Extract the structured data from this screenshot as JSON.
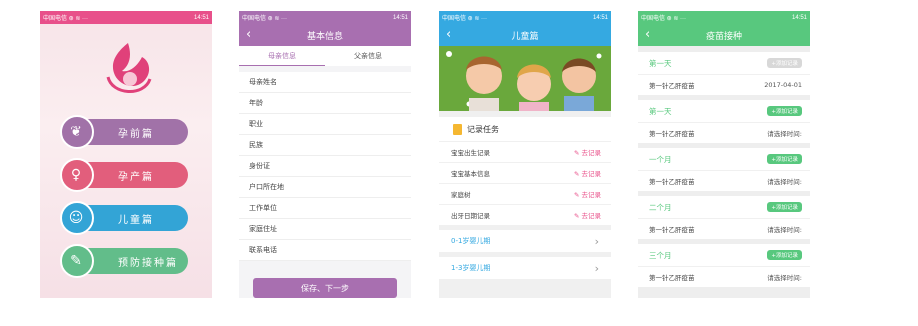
{
  "status_bar": {
    "carrier": "中国电信 ⊛ ≋ ···",
    "time": "14:51",
    "icons": "◉ ⊘ ▭"
  },
  "screen1": {
    "menu": [
      {
        "label": "孕前篇",
        "color": "#a172a8",
        "icon": "flower-icon",
        "glyph": "❦"
      },
      {
        "label": "孕产篇",
        "color": "#e25e7c",
        "icon": "pregnant-icon",
        "glyph": "♀"
      },
      {
        "label": "儿童篇",
        "color": "#33a4d6",
        "icon": "baby-face-icon",
        "glyph": "☺"
      },
      {
        "label": "预防接种篇",
        "color": "#62bd8a",
        "icon": "syringe-icon",
        "glyph": "✎"
      }
    ]
  },
  "screen2": {
    "title": "基本信息",
    "back_glyph": "‹",
    "tabs": [
      "母亲信息",
      "父亲信息"
    ],
    "fields": [
      "母亲姓名",
      "年龄",
      "职业",
      "民族",
      "身份证",
      "户口所在地",
      "工作单位",
      "家庭住址",
      "联系电话"
    ],
    "save_label": "保存、下一步"
  },
  "screen3": {
    "title": "儿童篇",
    "task_title": "记录任务",
    "tasks": [
      {
        "label": "宝宝出生记录",
        "action": "去记录"
      },
      {
        "label": "宝宝基本信息",
        "action": "去记录"
      },
      {
        "label": "家庭树",
        "action": "去记录"
      },
      {
        "label": "出牙日期记录",
        "action": "去记录"
      }
    ],
    "age_rows": [
      "0-1岁婴儿期",
      "1-3岁婴儿期"
    ],
    "chevron": "›"
  },
  "screen4": {
    "title": "疫苗接种",
    "groups": [
      {
        "period": "第一天",
        "add": "+添加记录",
        "disabled": true,
        "vaccine": "第一针乙肝疫苗",
        "value": "2017-04-01"
      },
      {
        "period": "第一天",
        "add": "+添加记录",
        "disabled": false,
        "vaccine": "第一针乙肝疫苗",
        "value": "请选择时间:"
      },
      {
        "period": "一个月",
        "add": "+添加记录",
        "disabled": false,
        "vaccine": "第一针乙肝疫苗",
        "value": "请选择时间:"
      },
      {
        "period": "二个月",
        "add": "+添加记录",
        "disabled": false,
        "vaccine": "第一针乙肝疫苗",
        "value": "请选择时间:"
      },
      {
        "period": "三个月",
        "add": "+添加记录",
        "disabled": false,
        "vaccine": "第一针乙肝疫苗",
        "value": "请选择时间:"
      }
    ]
  }
}
